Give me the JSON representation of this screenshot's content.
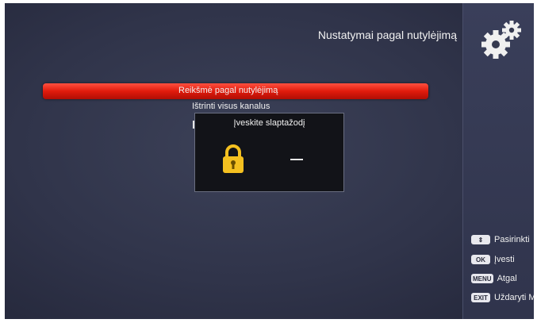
{
  "header": {
    "title": "Nustatymai pagal nutylėjimą"
  },
  "menu": {
    "items": [
      {
        "label": "Reikšmė pagal nutylėjimą",
        "selected": true
      },
      {
        "label": "Ištrinti visus kanalus",
        "selected": false
      }
    ]
  },
  "dialog": {
    "title": "Įveskite slaptažodį",
    "password_value": "–"
  },
  "hints": [
    {
      "key": "⇕",
      "label": "Pasirinkti"
    },
    {
      "key": "OK",
      "label": "Įvesti"
    },
    {
      "key": "MENU",
      "label": "Atgal"
    },
    {
      "key": "EXIT",
      "label": "Uždaryti M"
    }
  ],
  "colors": {
    "highlight": "#e01b0c",
    "background": "#30344a",
    "dialog_bg": "#121318",
    "lock": "#f4c020"
  },
  "icons": {
    "settings": "gear-icon",
    "lock": "lock-icon"
  }
}
